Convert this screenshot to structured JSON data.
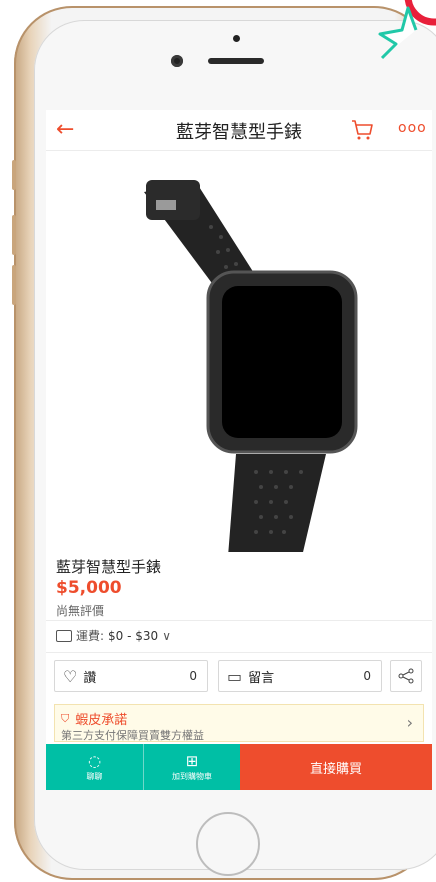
{
  "nav": {
    "back_icon": "arrow-left-icon",
    "title": "藍芽智慧型手錶",
    "cart_icon": "shopping-cart-icon",
    "more_icon": "more-dots-icon",
    "more_glyph": "ooo"
  },
  "product": {
    "name": "藍芽智慧型手錶",
    "price": "$5,000",
    "rating": "尚無評價",
    "shipping_label": "運費:",
    "shipping_value": "$0 - $30",
    "shipping_chevron": "∨"
  },
  "actions": {
    "like_label": "讚",
    "like_count": "0",
    "comment_label": "留言",
    "comment_count": "0"
  },
  "guarantee": {
    "title": "蝦皮承諾",
    "subtitle": "第三方支付保障買賣雙方權益",
    "arrow": "›"
  },
  "bottom": {
    "chat_label": "聊聊",
    "cart_label": "加到購物車",
    "buy_label": "直接購買"
  },
  "colors": {
    "accent": "#ee4d2d",
    "teal": "#00bfa5",
    "phone_gold": "#c6a57f"
  }
}
